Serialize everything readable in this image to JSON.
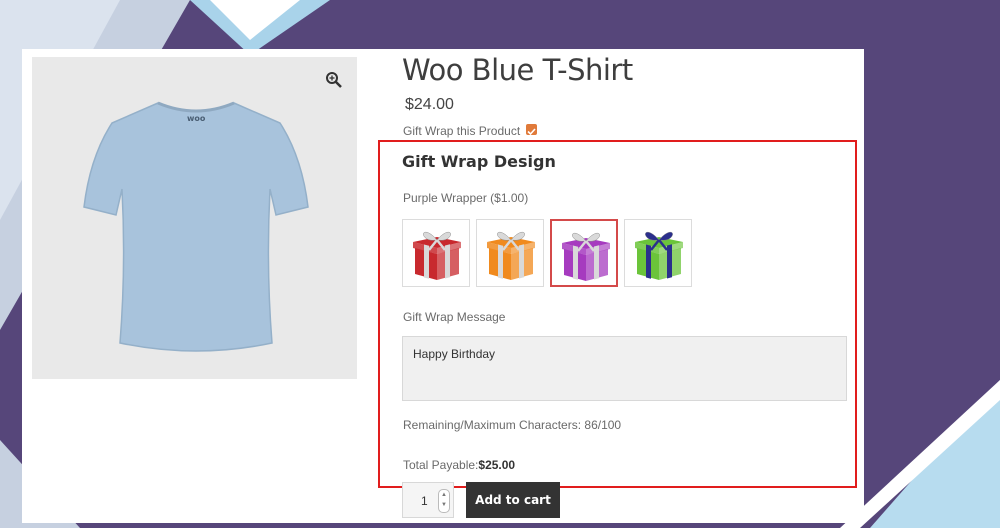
{
  "product": {
    "title": "Woo Blue T-Shirt",
    "price": "$24.00",
    "shirt_logo": "woo",
    "gift_wrap_label": "Gift Wrap this Product",
    "gift_wrap_checked": true
  },
  "gift_wrap": {
    "design_title": "Gift Wrap Design",
    "selected_name": "Purple Wrapper",
    "selected_price": "($1.00)",
    "options": [
      {
        "name": "red",
        "color": "#c8292e",
        "ribbon": "#d9d9d9"
      },
      {
        "name": "orange",
        "color": "#f08a1e",
        "ribbon": "#d9d9d9"
      },
      {
        "name": "purple",
        "color": "#a63bbf",
        "ribbon": "#d9d9d9",
        "selected": true
      },
      {
        "name": "green",
        "color": "#6bc43a",
        "ribbon": "#2b2f8c"
      }
    ],
    "message_label": "Gift Wrap Message",
    "message_value": "Happy Birthday",
    "remaining_label": "Remaining/Maximum Characters: 86/100",
    "total_label": "Total Payable:",
    "total_value": "$25.00"
  },
  "cart": {
    "quantity": "1",
    "add_label": "Add to cart"
  },
  "colors": {
    "accent_border": "#e11d1d",
    "checkbox": "#e07a3a",
    "button_bg": "#333333",
    "background": "#56467a"
  }
}
